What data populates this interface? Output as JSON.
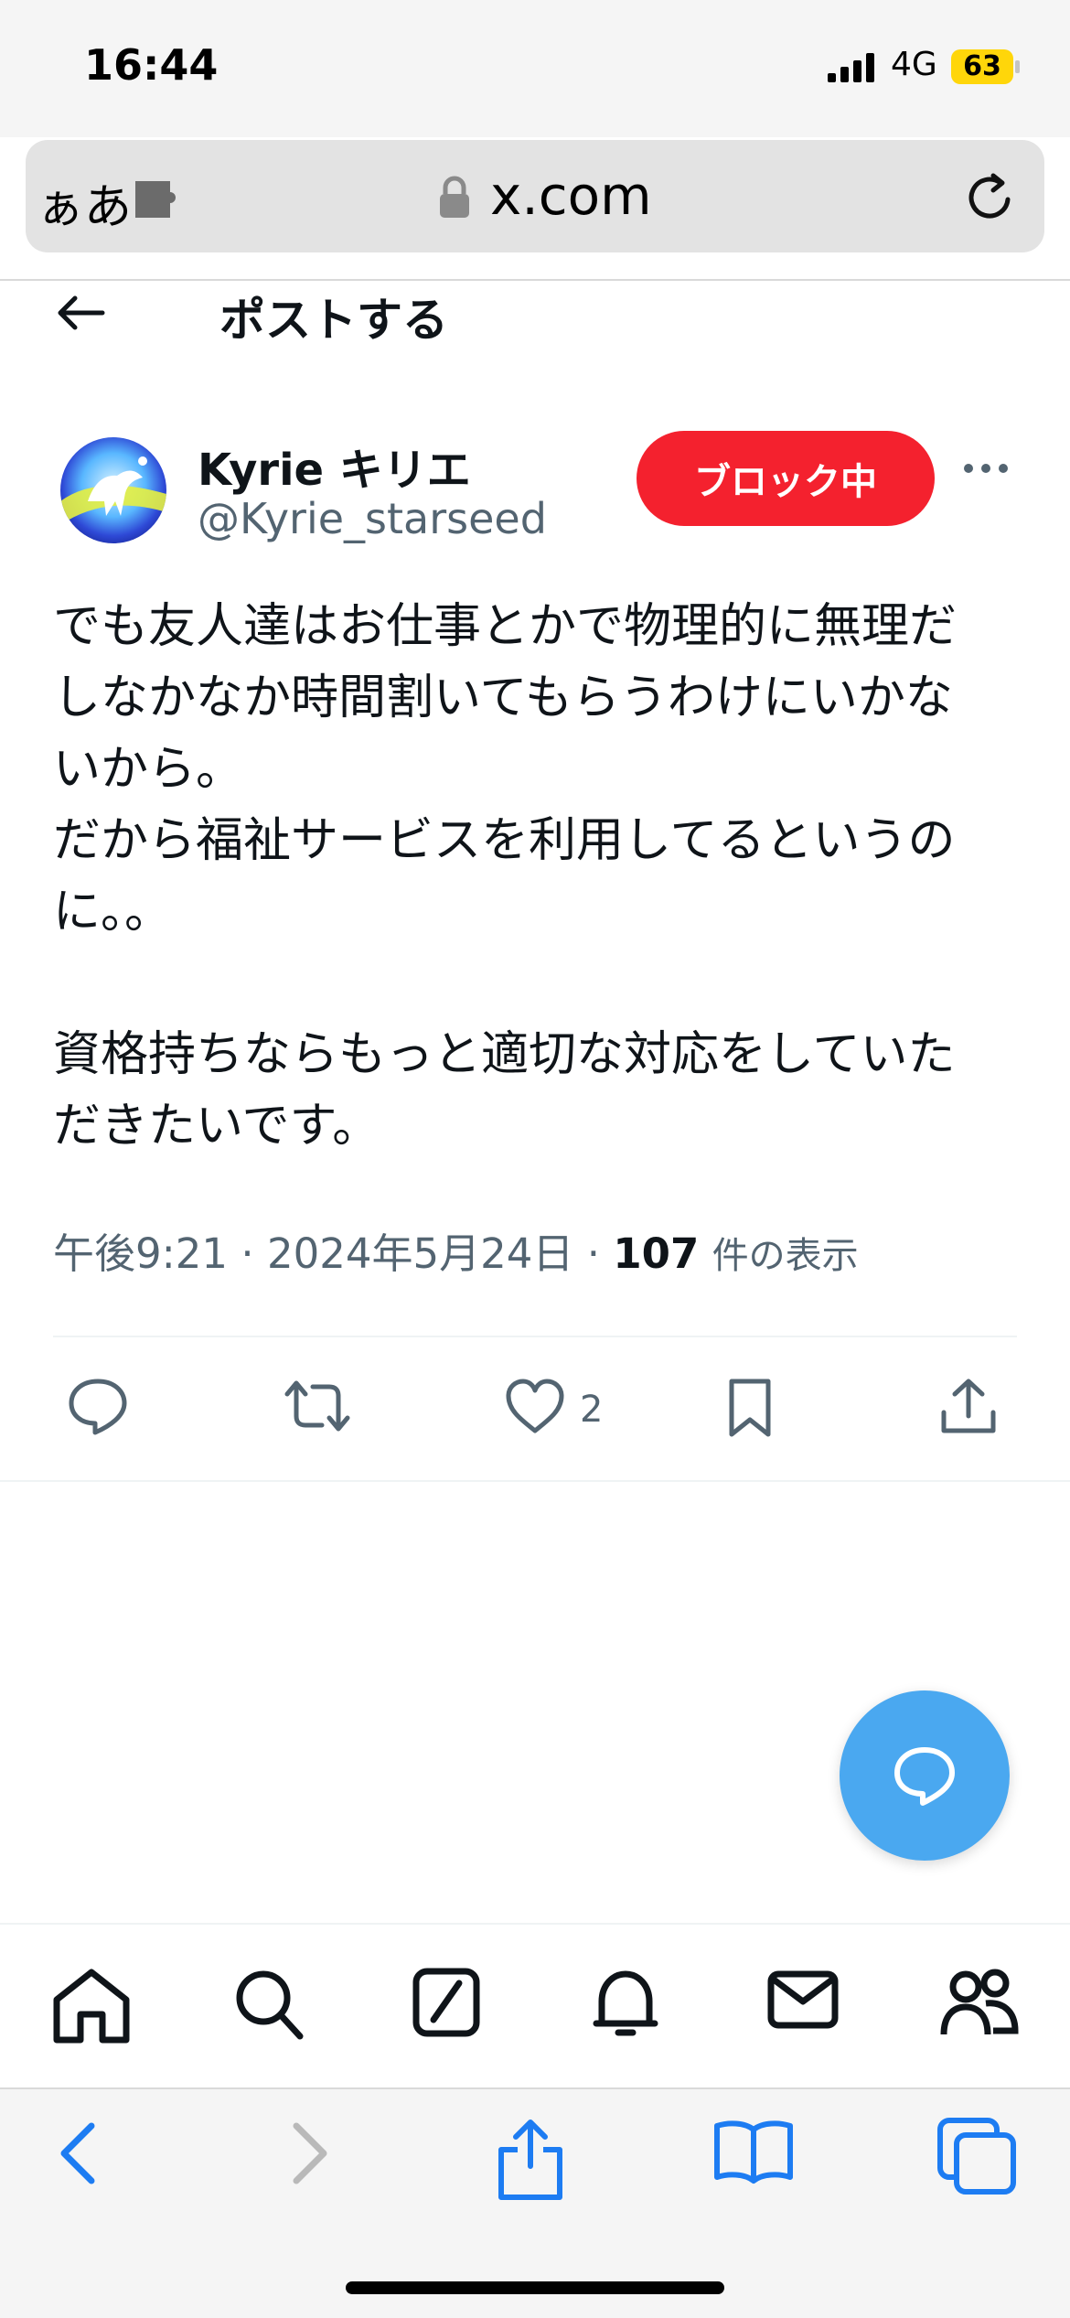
{
  "status_bar": {
    "time": "16:44",
    "network": "4G",
    "battery": "63"
  },
  "browser": {
    "text_size_label": "ぁあ",
    "url": "x.com"
  },
  "header": {
    "title": "ポストする"
  },
  "tweet": {
    "display_name": "Kyrie キリエ",
    "handle": "@Kyrie_starseed",
    "block_button_label": "ブロック中",
    "body_lines": [
      "でも友人達はお仕事とかで物理的に無理だ",
      "しなかなか時間割いてもらうわけにいかな",
      "いから。",
      "だから福祉サービスを利用してるというの",
      "に。。",
      "",
      "資格持ちならもっと適切な対応をしていた",
      "だきたいです。"
    ],
    "meta": {
      "time": "午後9:21",
      "separator": "·",
      "date": "2024年5月24日",
      "views_count": "107",
      "views_label": "件の表示"
    },
    "likes_count": "2"
  },
  "icons": {
    "reply": "reply-icon",
    "repost": "repost-icon",
    "like": "heart-icon",
    "bookmark": "bookmark-icon",
    "share": "share-icon"
  },
  "colors": {
    "block_red": "#f4212e",
    "fab_blue": "#4aa8f0",
    "link_blue": "#1d9bf0",
    "secondary_text": "#536471"
  }
}
